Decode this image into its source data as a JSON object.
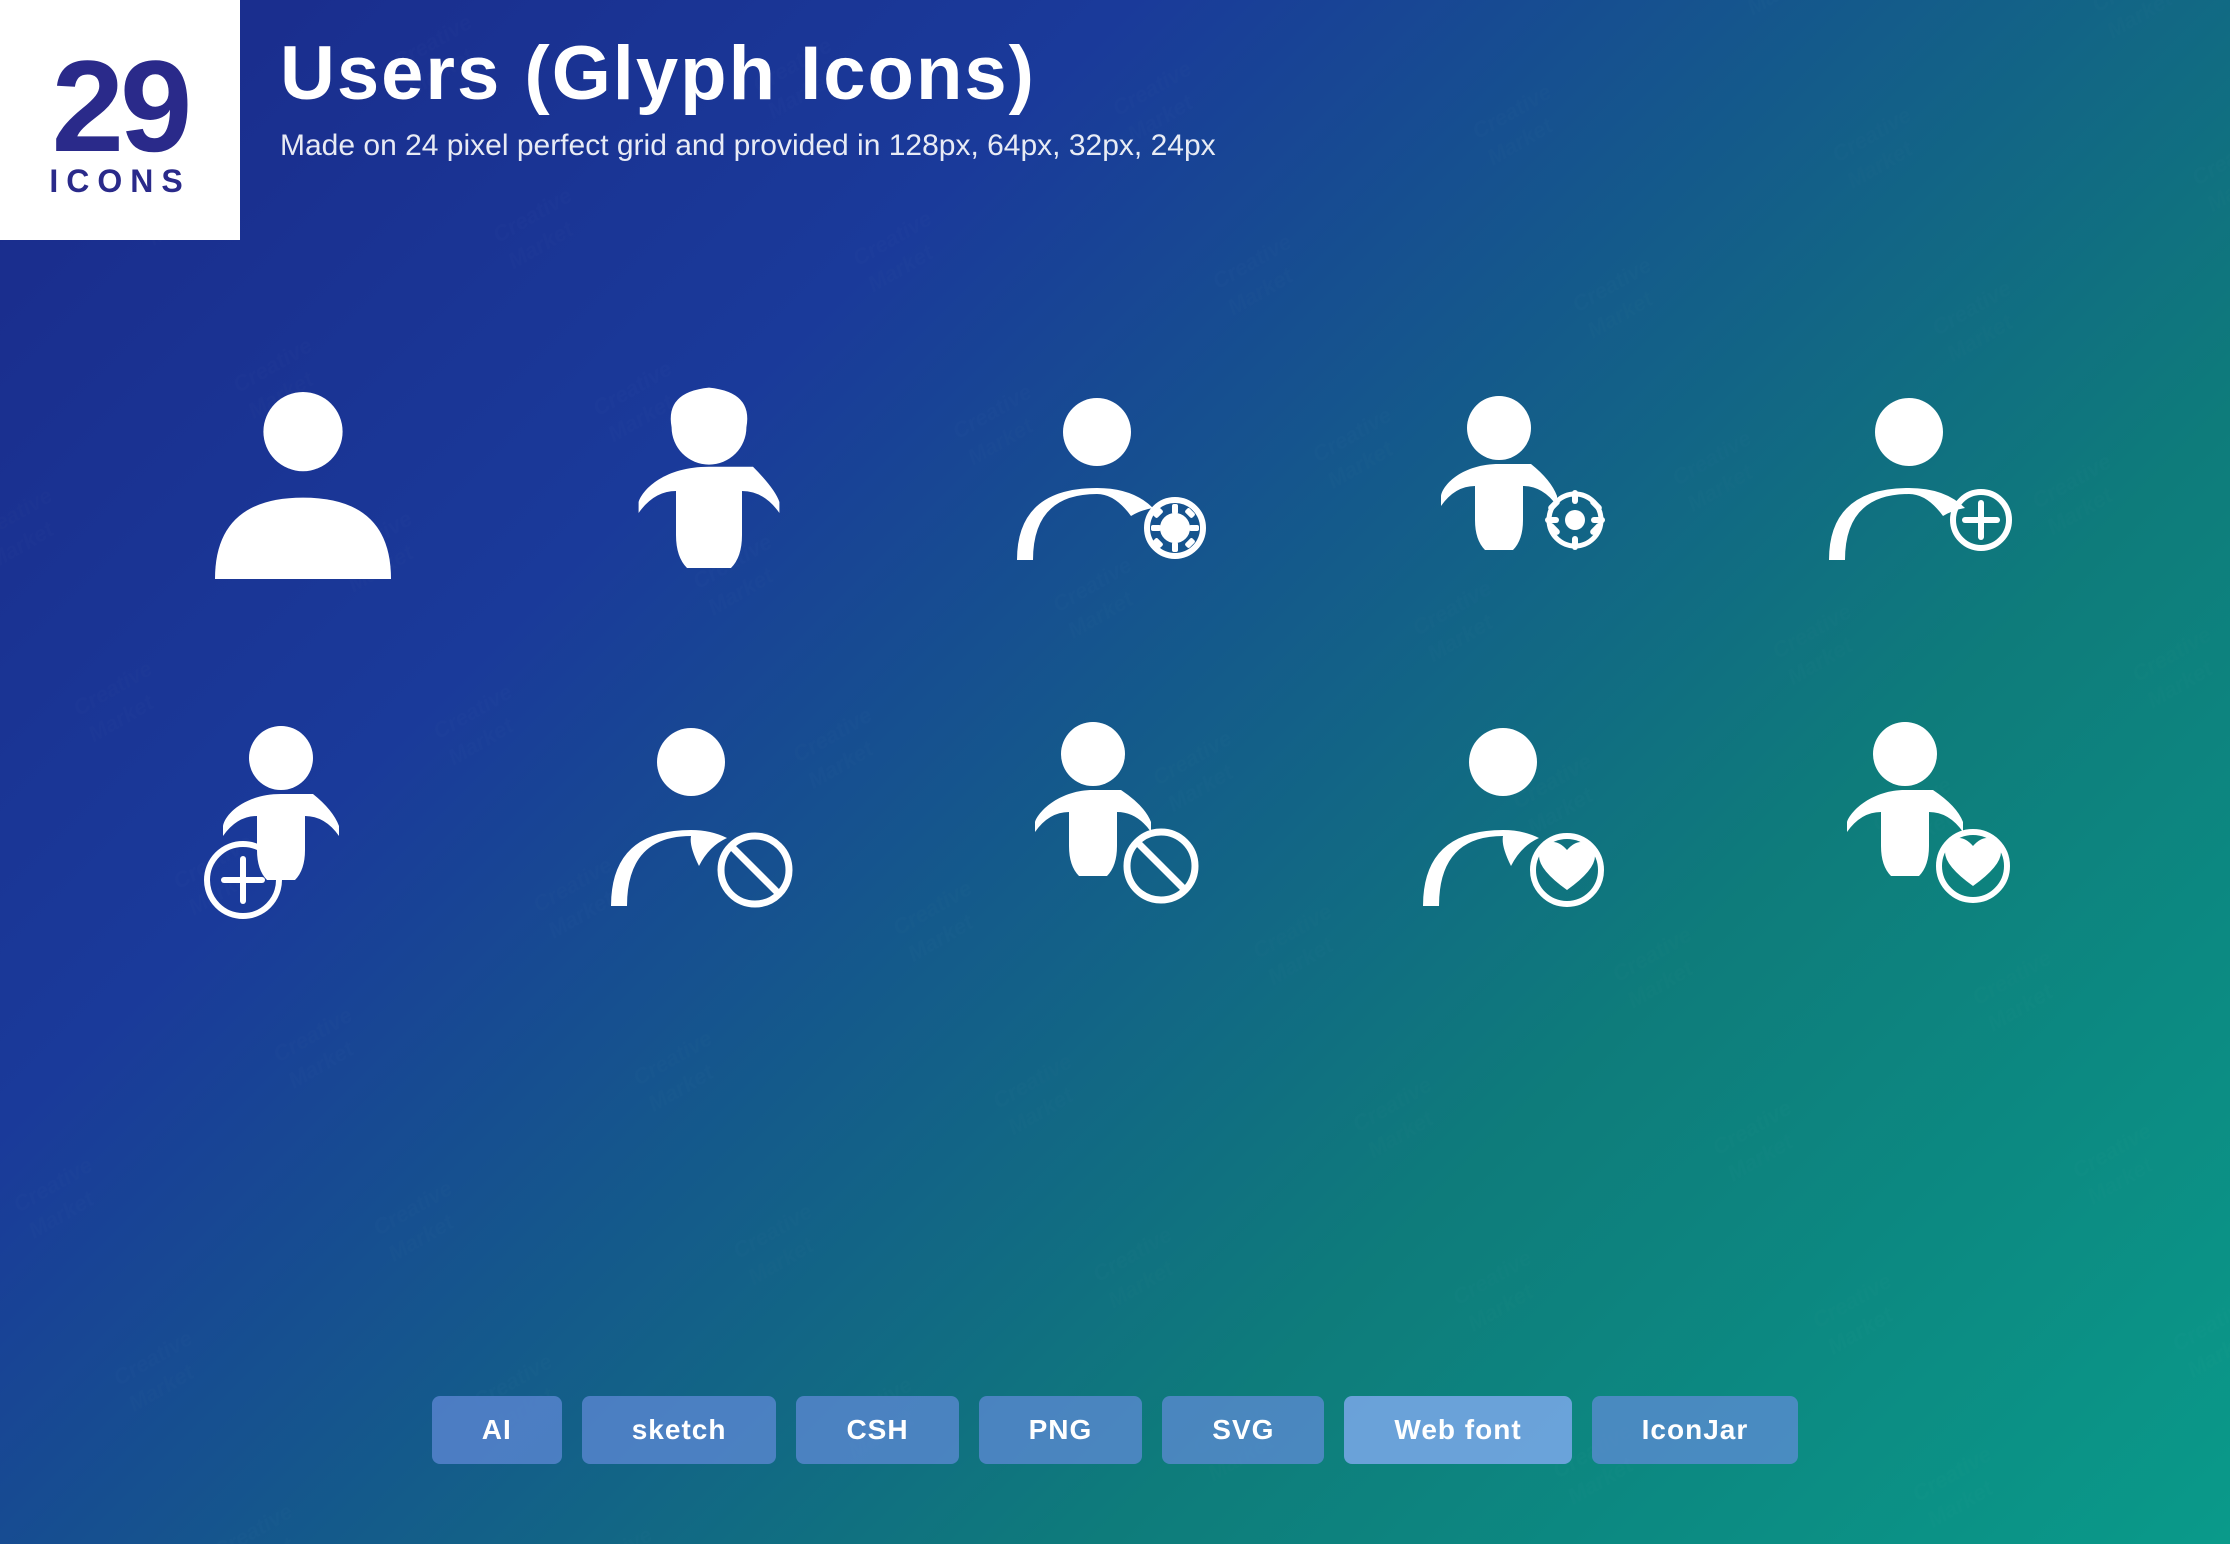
{
  "background": {
    "gradient": "linear-gradient(135deg, #1a2a8a 0%, #1a3a9a 30%, #0e7c7b 70%, #0a9a8a 100%)"
  },
  "top_left": {
    "number": "29",
    "label": "ICONS"
  },
  "header": {
    "title": "Users (Glyph Icons)",
    "subtitle": "Made on 24 pixel perfect grid and provided in 128px, 64px, 32px, 24px"
  },
  "icons_row1": [
    {
      "name": "male-user",
      "desc": "Male user silhouette"
    },
    {
      "name": "female-user",
      "desc": "Female user silhouette"
    },
    {
      "name": "male-user-settings",
      "desc": "Male user with gear"
    },
    {
      "name": "female-user-settings",
      "desc": "Female user with gear"
    },
    {
      "name": "male-user-add",
      "desc": "Male user with plus"
    }
  ],
  "icons_row2": [
    {
      "name": "female-user-add",
      "desc": "Female user with plus"
    },
    {
      "name": "male-user-block",
      "desc": "Male user with block"
    },
    {
      "name": "female-user-block",
      "desc": "Female user with block"
    },
    {
      "name": "male-user-heart",
      "desc": "Male user with heart"
    },
    {
      "name": "female-user-heart",
      "desc": "Female user with heart"
    }
  ],
  "badges": [
    {
      "label": "AI",
      "name": "ai-badge"
    },
    {
      "label": "sketch",
      "name": "sketch-badge"
    },
    {
      "label": "CSH",
      "name": "csh-badge"
    },
    {
      "label": "PNG",
      "name": "png-badge"
    },
    {
      "label": "SVG",
      "name": "svg-badge"
    },
    {
      "label": "Web font",
      "name": "webfont-badge"
    },
    {
      "label": "IconJar",
      "name": "iconjar-badge"
    }
  ],
  "watermark": {
    "text": "Creative Market"
  }
}
